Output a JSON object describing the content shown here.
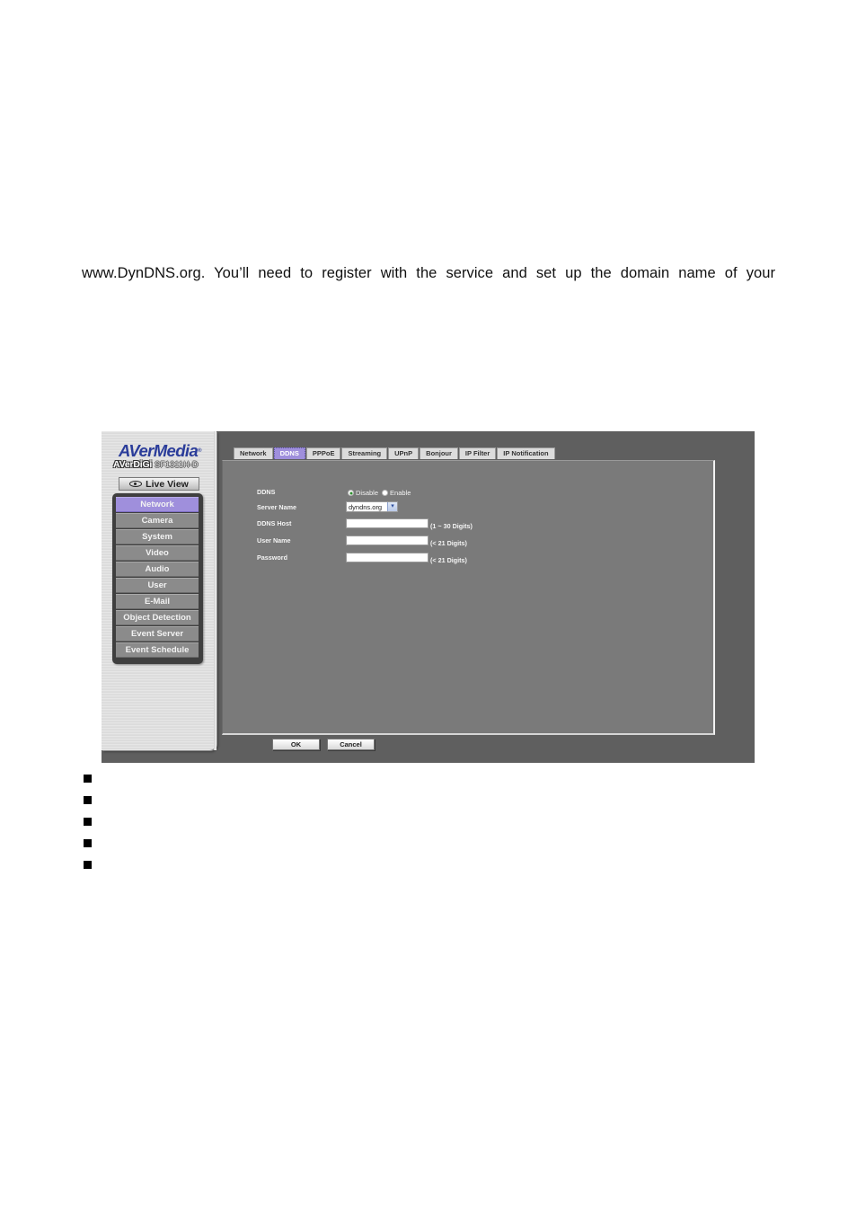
{
  "document": {
    "text_line": "www.DynDNS.org. You’ll need to register with the service and set up the domain name of your",
    "bullet_count": 5
  },
  "screenshot": {
    "logo": "AVerMedia",
    "logo_mark": "®",
    "model_brand": "AVerDiGi",
    "model_number": "SF1311H-D",
    "live_view_label": "Live View",
    "menu": [
      {
        "label": "Network",
        "active": true
      },
      {
        "label": "Camera",
        "active": false
      },
      {
        "label": "System",
        "active": false
      },
      {
        "label": "Video",
        "active": false
      },
      {
        "label": "Audio",
        "active": false
      },
      {
        "label": "User",
        "active": false
      },
      {
        "label": "E-Mail",
        "active": false
      },
      {
        "label": "Object Detection",
        "active": false
      },
      {
        "label": "Event Server",
        "active": false
      },
      {
        "label": "Event Schedule",
        "active": false
      }
    ],
    "tabs": [
      {
        "label": "Network",
        "active": false
      },
      {
        "label": "DDNS",
        "active": true
      },
      {
        "label": "PPPoE",
        "active": false
      },
      {
        "label": "Streaming",
        "active": false
      },
      {
        "label": "UPnP",
        "active": false
      },
      {
        "label": "Bonjour",
        "active": false
      },
      {
        "label": "IP Filter",
        "active": false
      },
      {
        "label": "IP Notification",
        "active": false
      }
    ],
    "form": {
      "ddns_label": "DDNS",
      "ddns_options": [
        "Disable",
        "Enable"
      ],
      "ddns_selected": "Disable",
      "server_name_label": "Server Name",
      "server_name_value": "dyndns.org",
      "ddns_host_label": "DDNS Host",
      "ddns_host_value": "",
      "ddns_host_hint": "(1 ~ 30 Digits)",
      "user_name_label": "User Name",
      "user_name_value": "",
      "user_name_hint": "(< 21 Digits)",
      "password_label": "Password",
      "password_value": "",
      "password_hint": "(< 21 Digits)"
    },
    "buttons": {
      "ok": "OK",
      "cancel": "Cancel"
    },
    "colors": {
      "accent_purple": "#9f8fdc",
      "panel_gray": "#7a7a7a",
      "background_gray": "#5f5f5f",
      "logo_blue": "#2a3c9a"
    }
  }
}
